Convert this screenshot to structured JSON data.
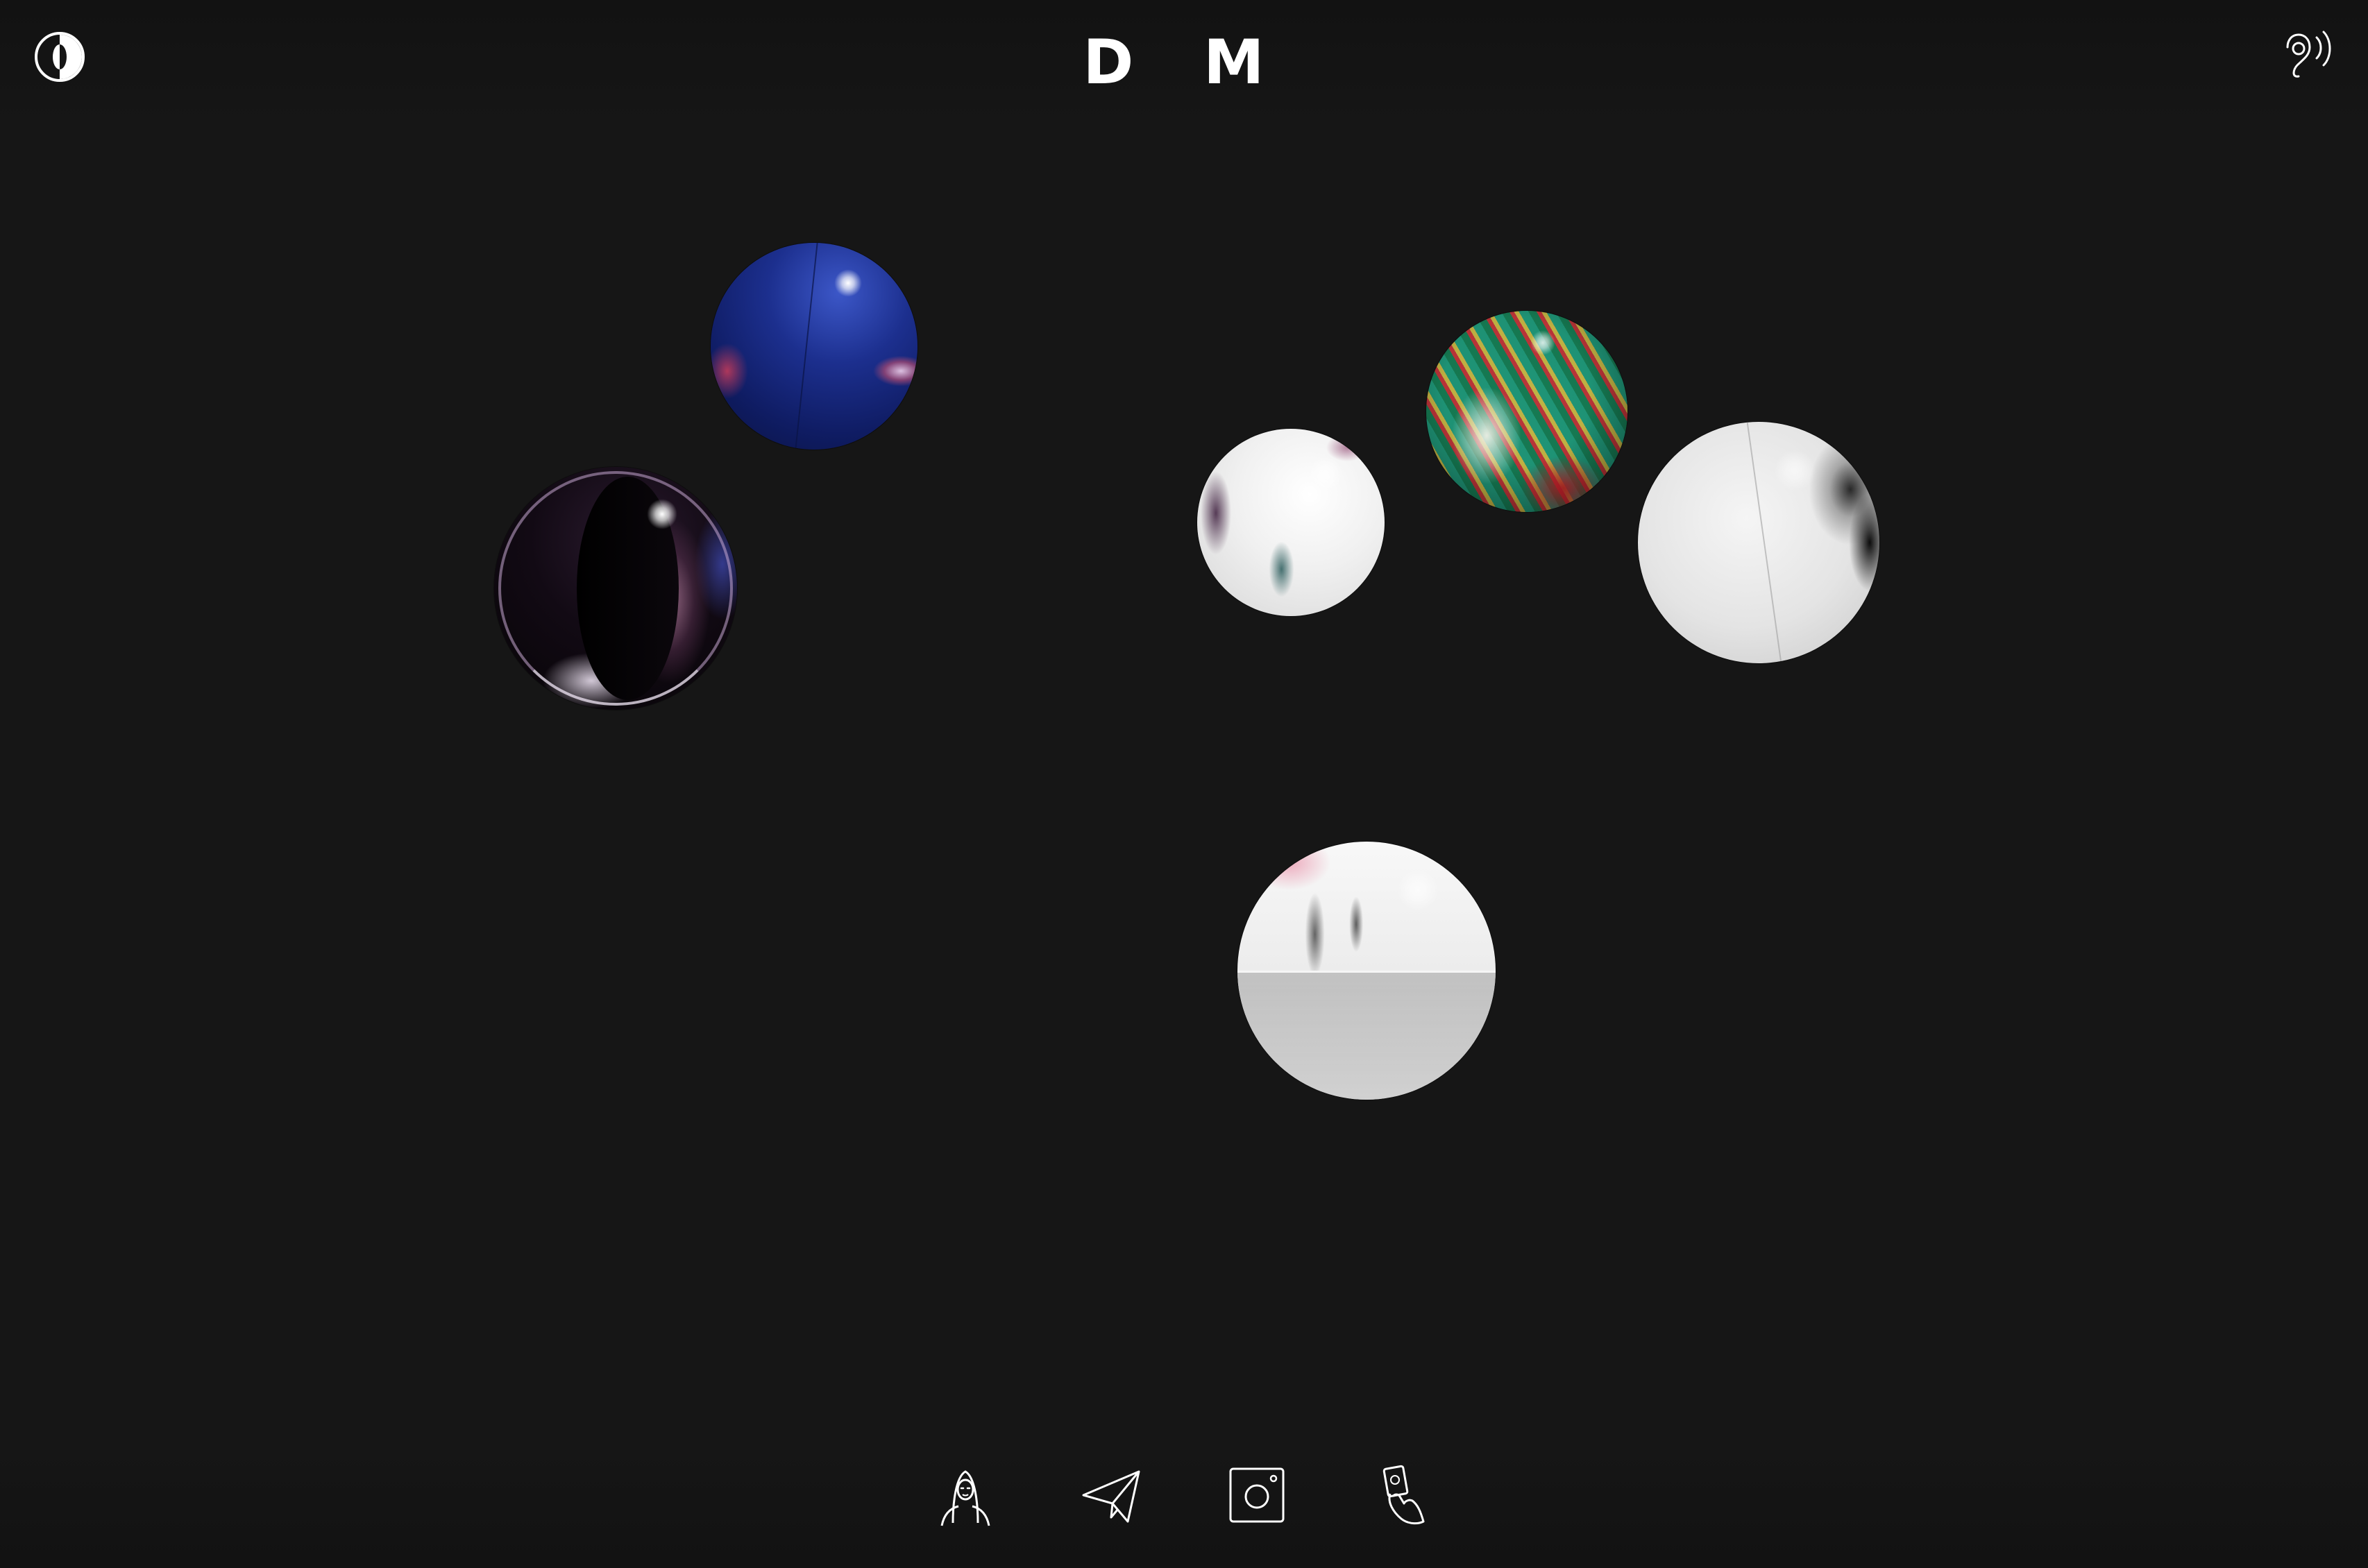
{
  "header": {
    "title_letter_1": "D",
    "title_letter_2": "M",
    "theme_toggle_icon": "half-moon-icon",
    "audio_toggle_icon": "ear-sound-icon"
  },
  "canvas": {
    "spheres": [
      {
        "name": "blue-sphere",
        "color": "#1c2f8e"
      },
      {
        "name": "dark-sphere",
        "color": "#120a14"
      },
      {
        "name": "white-sphere-small",
        "color": "#f0f0f0"
      },
      {
        "name": "colorful-sphere",
        "color": "#2a8a6a"
      },
      {
        "name": "white-sphere-large",
        "color": "#e4e4e4"
      },
      {
        "name": "chrome-sphere",
        "color": "#ececec"
      }
    ]
  },
  "nav": {
    "items": [
      {
        "icon": "mona-lisa-icon"
      },
      {
        "icon": "paper-plane-icon"
      },
      {
        "icon": "instagram-icon"
      },
      {
        "icon": "hand-card-icon"
      }
    ]
  },
  "colors": {
    "background": "#161616",
    "foreground": "#ffffff"
  }
}
